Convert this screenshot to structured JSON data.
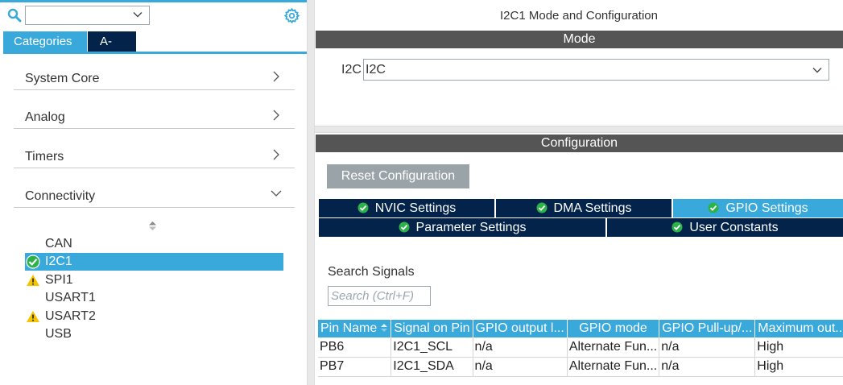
{
  "left_panel": {
    "search_value": "",
    "tabs": [
      {
        "label": "Categories",
        "active": true
      },
      {
        "label": "A->Z",
        "active": false
      }
    ],
    "categories": [
      {
        "label": "System Core",
        "expanded": false
      },
      {
        "label": "Analog",
        "expanded": false
      },
      {
        "label": "Timers",
        "expanded": false
      },
      {
        "label": "Connectivity",
        "expanded": true
      }
    ],
    "connectivity_items": [
      {
        "label": "CAN",
        "status": "none"
      },
      {
        "label": "I2C1",
        "status": "ok",
        "selected": true
      },
      {
        "label": "SPI1",
        "status": "warning"
      },
      {
        "label": "USART1",
        "status": "none"
      },
      {
        "label": "USART2",
        "status": "warning"
      },
      {
        "label": "USB",
        "status": "none"
      }
    ]
  },
  "right_panel": {
    "title": "I2C1 Mode and Configuration",
    "mode_header": "Mode",
    "mode_field_label": "I2C",
    "mode_field_value": "I2C",
    "config_header": "Configuration",
    "reset_button": "Reset Configuration",
    "config_tabs_row1": [
      {
        "label": "NVIC Settings",
        "active": false
      },
      {
        "label": "DMA Settings",
        "active": false
      },
      {
        "label": "GPIO Settings",
        "active": true
      }
    ],
    "config_tabs_row2": [
      {
        "label": "Parameter Settings",
        "active": false
      },
      {
        "label": "User Constants",
        "active": false
      }
    ],
    "search_signals_label": "Search Signals",
    "search_signals_placeholder": "Search (Ctrl+F)",
    "table": {
      "headers": [
        "Pin Name",
        "Signal on Pin",
        "GPIO output l...",
        "GPIO mode",
        "GPIO Pull-up/...",
        "Maximum out..."
      ],
      "rows": [
        [
          "PB6",
          "I2C1_SCL",
          "n/a",
          "Alternate Fun...",
          "n/a",
          "High"
        ],
        [
          "PB7",
          "I2C1_SDA",
          "n/a",
          "Alternate Fun...",
          "n/a",
          "High"
        ]
      ]
    }
  },
  "colors": {
    "accent": "#39a9db",
    "navy": "#03234b",
    "section_bar": "#555555",
    "ok_green": "#2db24a",
    "warning_yellow": "#f5c400"
  }
}
